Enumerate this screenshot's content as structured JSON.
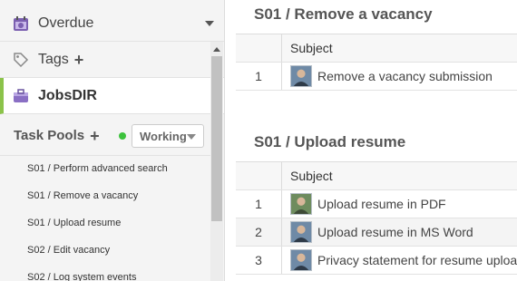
{
  "sidebar": {
    "nav": {
      "overdue": {
        "label": "Overdue",
        "icon": "overdue-calendar-icon"
      },
      "tags": {
        "label": "Tags",
        "icon": "tag-icon"
      },
      "jobsdir": {
        "label": "JobsDIR",
        "icon": "briefcase-icon",
        "accent": "#8bc34a"
      }
    },
    "task_pools": {
      "title": "Task Pools",
      "filter": {
        "selected": "Working",
        "status_color": "#3cc23c"
      },
      "items": [
        "S01 / Perform advanced search",
        "S01 / Remove a vacancy",
        "S01 / Upload resume",
        "S02 / Edit vacancy",
        "S02 / Log system events"
      ]
    }
  },
  "main": {
    "sections": [
      {
        "title": "S01 / Remove a vacancy",
        "header": "Subject",
        "rows": [
          {
            "num": "1",
            "subject": "Remove a vacancy submission"
          }
        ]
      },
      {
        "title": "S01 / Upload resume",
        "header": "Subject",
        "rows": [
          {
            "num": "1",
            "subject": "Upload resume in PDF"
          },
          {
            "num": "2",
            "subject": "Upload resume in MS Word"
          },
          {
            "num": "3",
            "subject": "Privacy statement for resume uploa"
          }
        ]
      }
    ]
  }
}
